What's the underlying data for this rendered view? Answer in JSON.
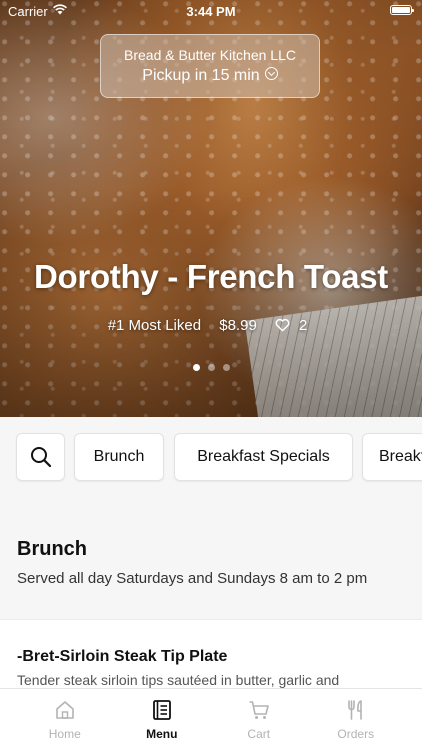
{
  "status_bar": {
    "carrier": "Carrier",
    "time": "3:44 PM"
  },
  "pickup": {
    "restaurant": "Bread & Butter Kitchen LLC",
    "pickup_time": "Pickup in 15 min"
  },
  "hero": {
    "title": "Dorothy - French Toast",
    "badge": "#1 Most Liked",
    "price": "$8.99",
    "likes": "2",
    "carousel": {
      "count": 3,
      "active": 0
    }
  },
  "categories": {
    "search_icon": "search-icon",
    "items": [
      "Brunch",
      "Breakfast Specials",
      "Breakfast"
    ]
  },
  "section": {
    "title": "Brunch",
    "description": "Served all day Saturdays and  Sundays  8 am to  2 pm"
  },
  "menu_item": {
    "name": "-Bret-Sirloin Steak Tip Plate",
    "description": "Tender steak sirloin tips sautéed in butter, garlic and"
  },
  "tabs": [
    {
      "label": "Home",
      "icon": "home-icon",
      "active": false
    },
    {
      "label": "Menu",
      "icon": "menu-book-icon",
      "active": true
    },
    {
      "label": "Cart",
      "icon": "cart-icon",
      "active": false
    },
    {
      "label": "Orders",
      "icon": "fork-knife-icon",
      "active": false
    }
  ],
  "colors": {
    "active_tab": "#111111",
    "inactive_tab": "#b3b3b3",
    "page_bg": "#f6f6f6"
  }
}
